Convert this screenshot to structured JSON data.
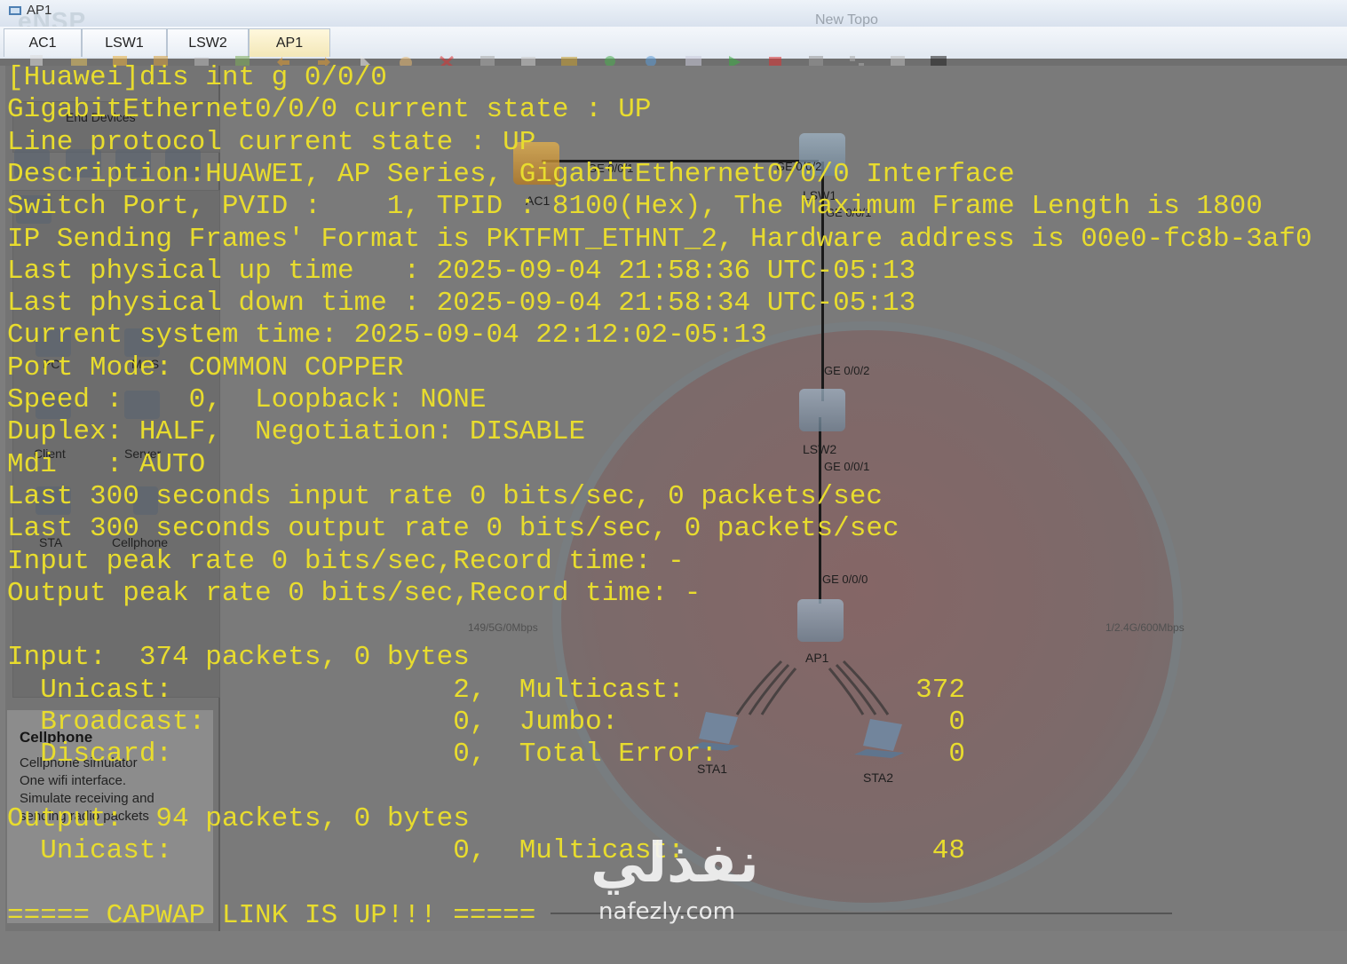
{
  "window": {
    "title": "AP1",
    "logo": "eNSP",
    "topo_title": "New Topo"
  },
  "tabs": [
    {
      "label": "AC1",
      "active": false
    },
    {
      "label": "LSW1",
      "active": false
    },
    {
      "label": "LSW2",
      "active": false
    },
    {
      "label": "AP1",
      "active": true
    }
  ],
  "left_panel": {
    "category_title": "End Devices",
    "devices": [
      "PC",
      "MCS",
      "Client",
      "Server",
      "STA",
      "Cellphone"
    ],
    "selected": {
      "title": "Cellphone",
      "desc_lines": [
        "Cellphone simulator",
        "One wifi interface.",
        "Simulate receiving and",
        "sending radio packets"
      ]
    }
  },
  "topology": {
    "nodes": {
      "ac1": "AC1",
      "lsw1": "LSW1",
      "lsw2": "LSW2",
      "ap1": "AP1",
      "sta1": "STA1",
      "sta2": "STA2"
    },
    "ports": {
      "ac1_ge001": "GE 0/0/1",
      "lsw1_ge002_top": "GE 0/0/2",
      "lsw1_ge001": "GE 0/0/1",
      "lsw2_ge002": "GE 0/0/2",
      "lsw2_ge001": "GE 0/0/1",
      "ap1_ge000": "GE 0/0/0"
    },
    "radio_left": "149/5G/0Mbps",
    "radio_right": "1/2.4G/600Mbps"
  },
  "terminal": {
    "lines": [
      "[Huawei]dis int g 0/0/0",
      "GigabitEthernet0/0/0 current state : UP",
      "Line protocol current state : UP",
      "Description:HUAWEI, AP Series, GigabitEthernet0/0/0 Interface",
      "Switch Port, PVID :    1, TPID : 8100(Hex), The Maximum Frame Length is 1800",
      "IP Sending Frames' Format is PKTFMT_ETHNT_2, Hardware address is 00e0-fc8b-3af0",
      "Last physical up time   : 2025-09-04 21:58:36 UTC-05:13",
      "Last physical down time : 2025-09-04 21:58:34 UTC-05:13",
      "Current system time: 2025-09-04 22:12:02-05:13",
      "Port Mode: COMMON COPPER",
      "Speed :    0,  Loopback: NONE",
      "Duplex: HALF,  Negotiation: DISABLE",
      "Mdi   : AUTO",
      "Last 300 seconds input rate 0 bits/sec, 0 packets/sec",
      "Last 300 seconds output rate 0 bits/sec, 0 packets/sec",
      "Input peak rate 0 bits/sec,Record time: -",
      "Output peak rate 0 bits/sec,Record time: -",
      "",
      "Input:  374 packets, 0 bytes",
      "  Unicast:                 2,  Multicast:              372",
      "  Broadcast:               0,  Jumbo:                    0",
      "  Discard:                 0,  Total Error:              0",
      "",
      "Output:  94 packets, 0 bytes",
      "  Unicast:                 0,  Multicast:               48",
      "",
      "===== CAPWAP LINK IS UP!!! ====="
    ]
  },
  "watermark": {
    "arabic": "نفذلي",
    "latin": "nafezly.com"
  }
}
